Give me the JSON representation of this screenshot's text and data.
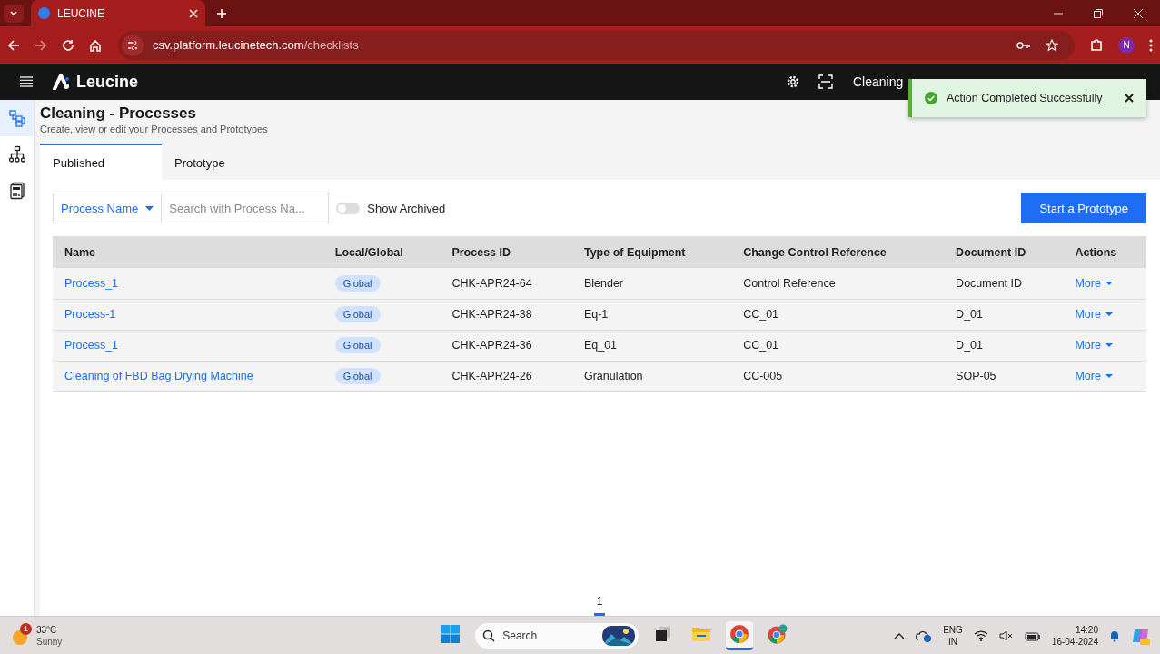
{
  "browser": {
    "tab_title": "LEUCINE",
    "url_host": "csv.platform.leucinetech.com",
    "url_path": "/checklists",
    "profile": "N"
  },
  "app": {
    "brand": "Leucine",
    "header_items": [
      "Cleaning"
    ]
  },
  "toast": {
    "message": "Action Completed Successfully"
  },
  "sidebar": {
    "items": [
      {
        "kind": "flow",
        "selected": true
      },
      {
        "kind": "tree",
        "selected": false
      },
      {
        "kind": "report",
        "selected": false
      }
    ]
  },
  "page": {
    "title": "Cleaning - Processes",
    "subtitle": "Create, view or edit your Processes and Prototypes"
  },
  "tabs": [
    {
      "label": "Published",
      "selected": true
    },
    {
      "label": "Prototype",
      "selected": false
    }
  ],
  "filters": {
    "dropdown": "Process Name",
    "search_placeholder": "Search with Process Na...",
    "toggle": {
      "label": "Show Archived",
      "on": false
    },
    "button": "Start a Prototype"
  },
  "table": {
    "columns": [
      "Name",
      "Local/Global",
      "Process ID",
      "Type of Equipment",
      "Change Control Reference",
      "Document ID",
      "Actions"
    ],
    "rows": [
      {
        "name": "Process_1",
        "scope": "Global",
        "process_id": "CHK-APR24-64",
        "equipment": "Blender",
        "change_ref": "Control Reference",
        "document_id": "Document ID",
        "action": "More"
      },
      {
        "name": "Process-1",
        "scope": "Global",
        "process_id": "CHK-APR24-38",
        "equipment": "Eq-1",
        "change_ref": "CC_01",
        "document_id": "D_01",
        "action": "More"
      },
      {
        "name": "Process_1",
        "scope": "Global",
        "process_id": "CHK-APR24-36",
        "equipment": "Eq_01",
        "change_ref": "CC_01",
        "document_id": "D_01",
        "action": "More"
      },
      {
        "name": "Cleaning of FBD Bag Drying Machine",
        "scope": "Global",
        "process_id": "CHK-APR24-26",
        "equipment": "Granulation",
        "change_ref": "CC-005",
        "document_id": "SOP-05",
        "action": "More"
      }
    ]
  },
  "pagination": {
    "pages": [
      {
        "label": "1",
        "selected": true
      }
    ]
  },
  "taskbar": {
    "weather": {
      "temperature": "33°C",
      "condition": "Sunny",
      "badge": "1"
    },
    "search_placeholder": "Search",
    "apps": [
      {
        "kind": "start",
        "selected": false
      },
      {
        "kind": "taskview",
        "selected": false
      },
      {
        "kind": "files",
        "selected": false
      },
      {
        "kind": "chrome",
        "selected": true
      },
      {
        "kind": "chrome-profile",
        "selected": false
      }
    ],
    "language": "ENG",
    "region": "IN",
    "time": "14:20",
    "date": "16-04-2024"
  }
}
